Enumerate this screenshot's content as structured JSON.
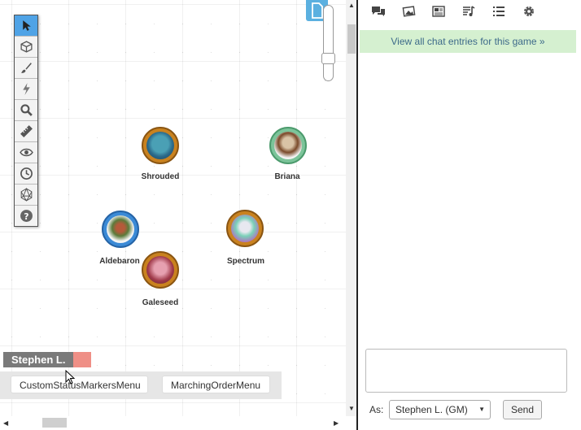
{
  "map": {
    "tokens": [
      {
        "name": "Shrouded"
      },
      {
        "name": "Briana"
      },
      {
        "name": "Aldebaron"
      },
      {
        "name": "Spectrum"
      },
      {
        "name": "Galeseed"
      }
    ]
  },
  "toolbar": {
    "tools": [
      "select-icon",
      "cube-icon",
      "brush-icon",
      "lightning-icon",
      "magnifier-icon",
      "ruler-icon",
      "eye-icon",
      "clock-icon",
      "dice-icon",
      "help-icon"
    ]
  },
  "player": {
    "name": "Stephen L.",
    "color": "#ef8f86"
  },
  "macros": {
    "macro1": "CustomStatusMarkersMenu",
    "macro2": "MarchingOrderMenu"
  },
  "panel": {
    "tabs": [
      "chat-icon",
      "art-icon",
      "journal-icon",
      "jukebox-icon",
      "collection-icon",
      "settings-icon"
    ],
    "archive_link": "View all chat entries for this game »",
    "as_label": "As:",
    "as_value": "Stephen L. (GM)",
    "send_label": "Send"
  },
  "colors": {
    "accent": "#4fa3e6",
    "archive_bg": "#d5f0d0",
    "archive_text": "#3d6a8a"
  }
}
